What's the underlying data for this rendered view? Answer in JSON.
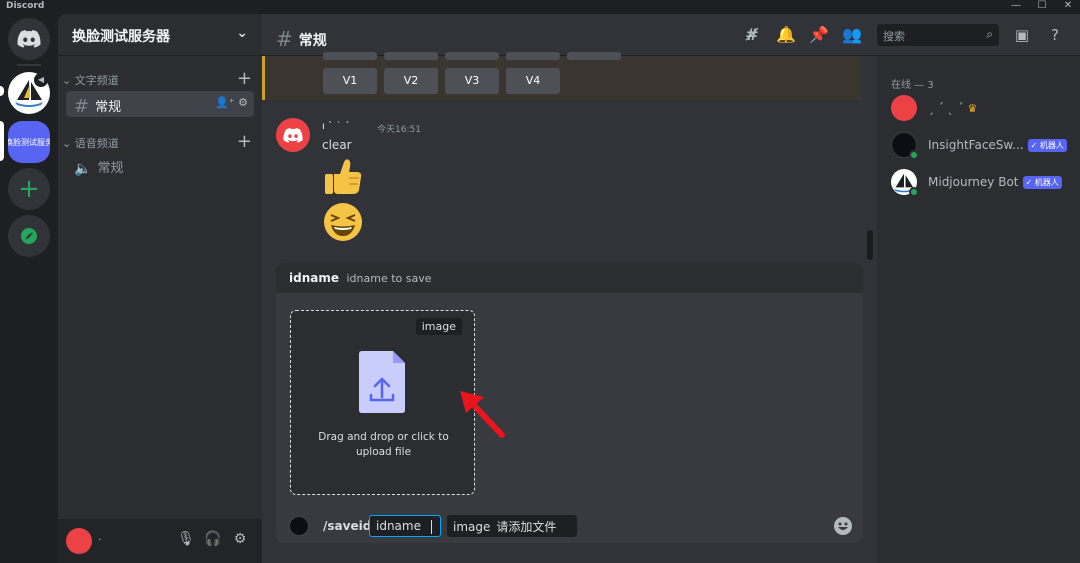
{
  "titlebar": {
    "app_name": "Discord",
    "min": "—",
    "max": "☐",
    "close": "✕"
  },
  "rail": {
    "active_server_label": "换脸测试服务"
  },
  "sidebar": {
    "server_name": "换脸测试服务器",
    "text_category": "文字频道",
    "voice_category": "语音频道",
    "text_channels": [
      {
        "label": "常规"
      }
    ],
    "voice_channels": [
      {
        "label": "常规"
      }
    ],
    "user_name": "·"
  },
  "header": {
    "channel_name": "常规"
  },
  "embed": {
    "buttons": [
      "V1",
      "V2",
      "V3",
      "V4"
    ]
  },
  "message": {
    "author": "ı ˋ ˙ ˊ",
    "timestamp": "今天16:51",
    "text": "clear"
  },
  "command": {
    "option_name": "idname",
    "option_desc": "idname to save",
    "dropzone_tag": "image",
    "dropzone_text": "Drag and drop or click to upload file",
    "slash": "/saveid",
    "opt1_label": "idname",
    "opt2_label": "image",
    "opt2_value": "请添加文件"
  },
  "members": {
    "search_placeholder": "搜索",
    "group_label": "在线 — 3",
    "list": [
      {
        "name": "ˏ ˊ  ˎ  ˊ",
        "badge": "",
        "crown": "♛"
      },
      {
        "name": "InsightFaceSw...",
        "badge": "✓ 机器人",
        "crown": ""
      },
      {
        "name": "Midjourney Bot",
        "badge": "✓ 机器人",
        "crown": ""
      }
    ]
  },
  "colors": {
    "accent": "#5865f2",
    "online": "#23a55a",
    "danger": "#ed4245",
    "arrow": "#e8161c"
  }
}
